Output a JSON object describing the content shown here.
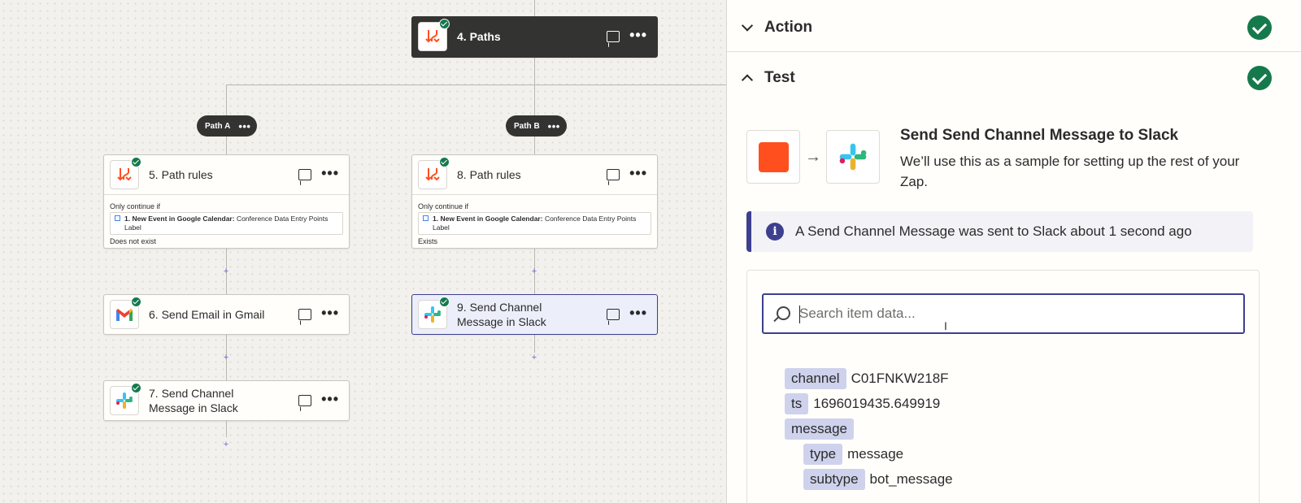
{
  "canvas": {
    "steps": {
      "paths": {
        "title": "4. Paths"
      },
      "path_a": {
        "label": "Path A"
      },
      "path_b": {
        "label": "Path B"
      },
      "rules_a": {
        "title": "5. Path rules",
        "condition_label": "Only continue if",
        "field_app": "1. New Event in Google Calendar:",
        "field_name": "Conference Data Entry Points Label",
        "operator": "Does not exist"
      },
      "rules_b": {
        "title": "8. Path rules",
        "condition_label": "Only continue if",
        "field_app": "1. New Event in Google Calendar:",
        "field_name": "Conference Data Entry Points Label",
        "operator": "Exists"
      },
      "gmail": {
        "title": "6. Send Email in Gmail"
      },
      "slack_a": {
        "title": "7. Send Channel Message in Slack"
      },
      "slack_b": {
        "title": "9. Send Channel Message in Slack"
      }
    },
    "dots": "•••",
    "plus": "+"
  },
  "panel": {
    "action": {
      "title": "Action"
    },
    "test": {
      "title": "Test"
    },
    "sample": {
      "title": "Send Send Channel Message to Slack",
      "description": "We’ll use this as a sample for setting up the rest of your Zap."
    },
    "banner": {
      "text": "A Send Channel Message was sent to Slack about 1 second ago"
    },
    "search": {
      "placeholder": "Search item data..."
    },
    "fields": [
      {
        "key": "channel",
        "value": "C01FNKW218F"
      },
      {
        "key": "ts",
        "value": "1696019435.649919"
      },
      {
        "key": "message",
        "value": ""
      },
      {
        "key": "type",
        "value": "message"
      },
      {
        "key": "subtype",
        "value": "bot_message"
      }
    ]
  },
  "colors": {
    "accent": "#3d3f8f",
    "success": "#16794c",
    "zapier_orange": "#ff4f1f",
    "dark_step": "#333331"
  }
}
